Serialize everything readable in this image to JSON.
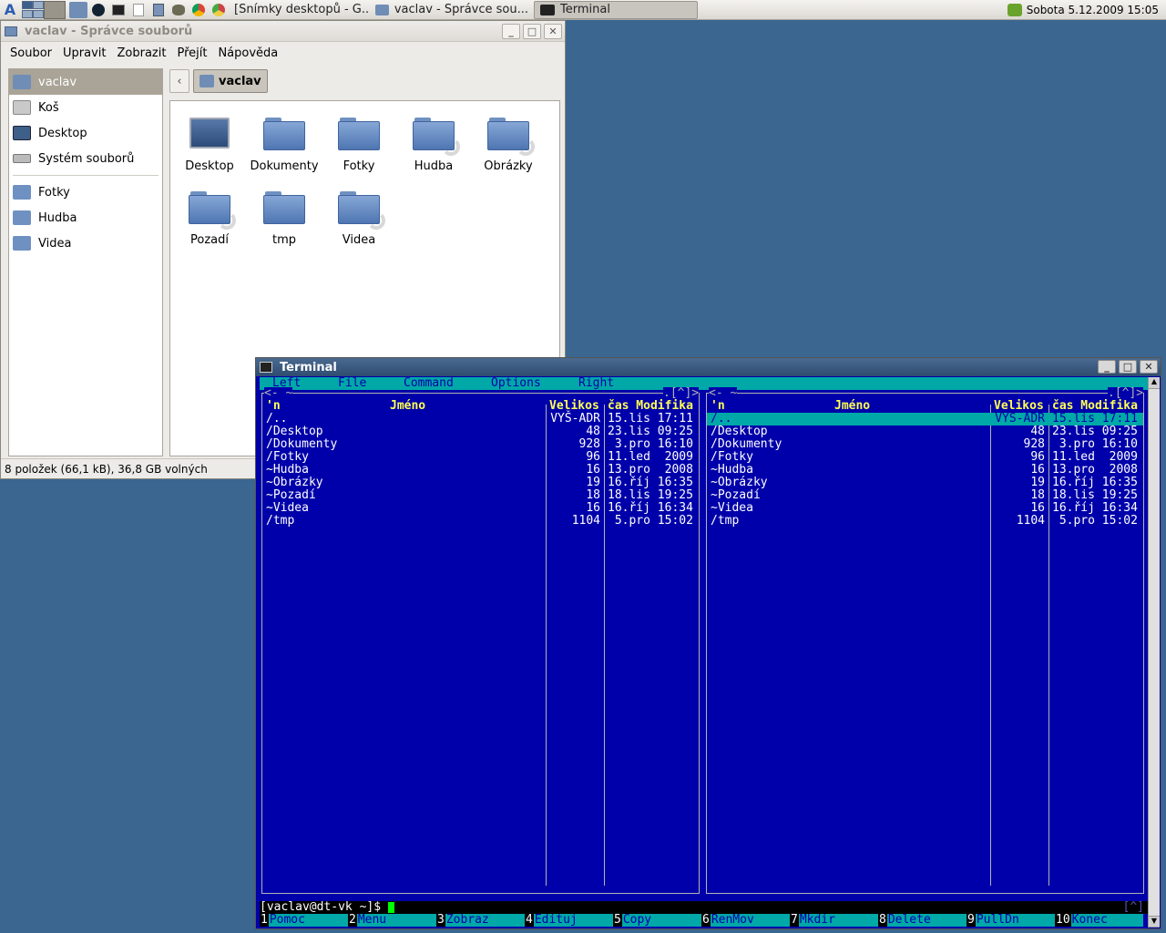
{
  "taskbar": {
    "tasks": [
      {
        "label": "[Snímky desktopů - G..."
      },
      {
        "label": "vaclav - Správce sou..."
      },
      {
        "label": "Terminal"
      }
    ],
    "clock": "Sobota 5.12.2009 15:05"
  },
  "filemanager": {
    "title": "vaclav - Správce souborů",
    "menu": [
      "Soubor",
      "Upravit",
      "Zobrazit",
      "Přejít",
      "Nápověda"
    ],
    "sidebar": {
      "places": [
        "vaclav",
        "Koš",
        "Desktop",
        "Systém souborů"
      ],
      "bookmarks": [
        "Fotky",
        "Hudba",
        "Videa"
      ]
    },
    "path": {
      "crumb": "vaclav"
    },
    "items": [
      {
        "label": "Desktop",
        "kind": "desktop"
      },
      {
        "label": "Dokumenty",
        "kind": "folder"
      },
      {
        "label": "Fotky",
        "kind": "folder"
      },
      {
        "label": "Hudba",
        "kind": "link"
      },
      {
        "label": "Obrázky",
        "kind": "link"
      },
      {
        "label": "Pozadí",
        "kind": "link"
      },
      {
        "label": "tmp",
        "kind": "folder"
      },
      {
        "label": "Videa",
        "kind": "link"
      }
    ],
    "status": "8 položek (66,1 kB), 36,8 GB volných"
  },
  "terminal": {
    "title": "Terminal",
    "menubar": [
      "Left",
      "File",
      "Command",
      "Options",
      "Right"
    ],
    "panel_header": {
      "sort": "'n",
      "name": "Jméno",
      "size": "Velikos",
      "time": "čas Modifika"
    },
    "left_top": "<- ~",
    "right_top": "<- ~",
    "panel_corner": ".[^]>",
    "rows": [
      {
        "name": "/..",
        "size": "VYŠ-ADR",
        "time": "15.lis 17:11"
      },
      {
        "name": "/Desktop",
        "size": "48",
        "time": "23.lis 09:25"
      },
      {
        "name": "/Dokumenty",
        "size": "928",
        "time": " 3.pro 16:10"
      },
      {
        "name": "/Fotky",
        "size": "96",
        "time": "11.led  2009"
      },
      {
        "name": "~Hudba",
        "size": "16",
        "time": "13.pro  2008"
      },
      {
        "name": "~Obrázky",
        "size": "19",
        "time": "16.říj 16:35"
      },
      {
        "name": "~Pozadí",
        "size": "18",
        "time": "18.lis 19:25"
      },
      {
        "name": "~Videa",
        "size": "16",
        "time": "16.říj 16:34"
      },
      {
        "name": "/tmp",
        "size": "1104",
        "time": " 5.pro 15:02"
      }
    ],
    "prompt": "[vaclav@dt-vk ~]$ ",
    "prompt_right": "[^]",
    "fkeys": [
      {
        "n": "1",
        "l": "Pomoc"
      },
      {
        "n": "2",
        "l": "Menu"
      },
      {
        "n": "3",
        "l": "Zobraz"
      },
      {
        "n": "4",
        "l": "Edituj"
      },
      {
        "n": "5",
        "l": "Copy"
      },
      {
        "n": "6",
        "l": "RenMov"
      },
      {
        "n": "7",
        "l": "Mkdir"
      },
      {
        "n": "8",
        "l": "Delete"
      },
      {
        "n": "9",
        "l": "PullDn"
      },
      {
        "n": "10",
        "l": "Konec"
      }
    ]
  }
}
